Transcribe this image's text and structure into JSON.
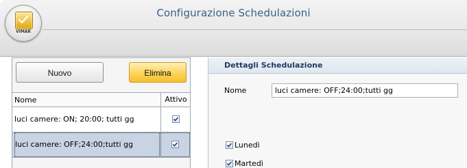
{
  "window": {
    "title": "Configurazione Schedulazioni"
  },
  "logo": {
    "text": "VIMAR",
    "icon": "gold-app-icon"
  },
  "toolbar": {
    "new_label": "Nuovo",
    "delete_label": "Elimina"
  },
  "table": {
    "columns": [
      "Nome",
      "Attivo"
    ],
    "rows": [
      {
        "name": "luci camere: ON; 20:00; tutti gg",
        "active": true,
        "selected": false
      },
      {
        "name": "luci camere: OFF;24:00;tutti gg",
        "active": true,
        "selected": true
      }
    ]
  },
  "details": {
    "header": "Dettagli Schedulazione",
    "name_label": "Nome",
    "name_value": "luci camere: OFF;24:00;tutti gg",
    "days": [
      {
        "label": "Lunedì",
        "checked": true
      },
      {
        "label": "Martedì",
        "checked": true
      }
    ]
  },
  "colors": {
    "title": "#3a5e86",
    "selected_row": "#c8d3e4",
    "delete_button": "#fcd660"
  }
}
